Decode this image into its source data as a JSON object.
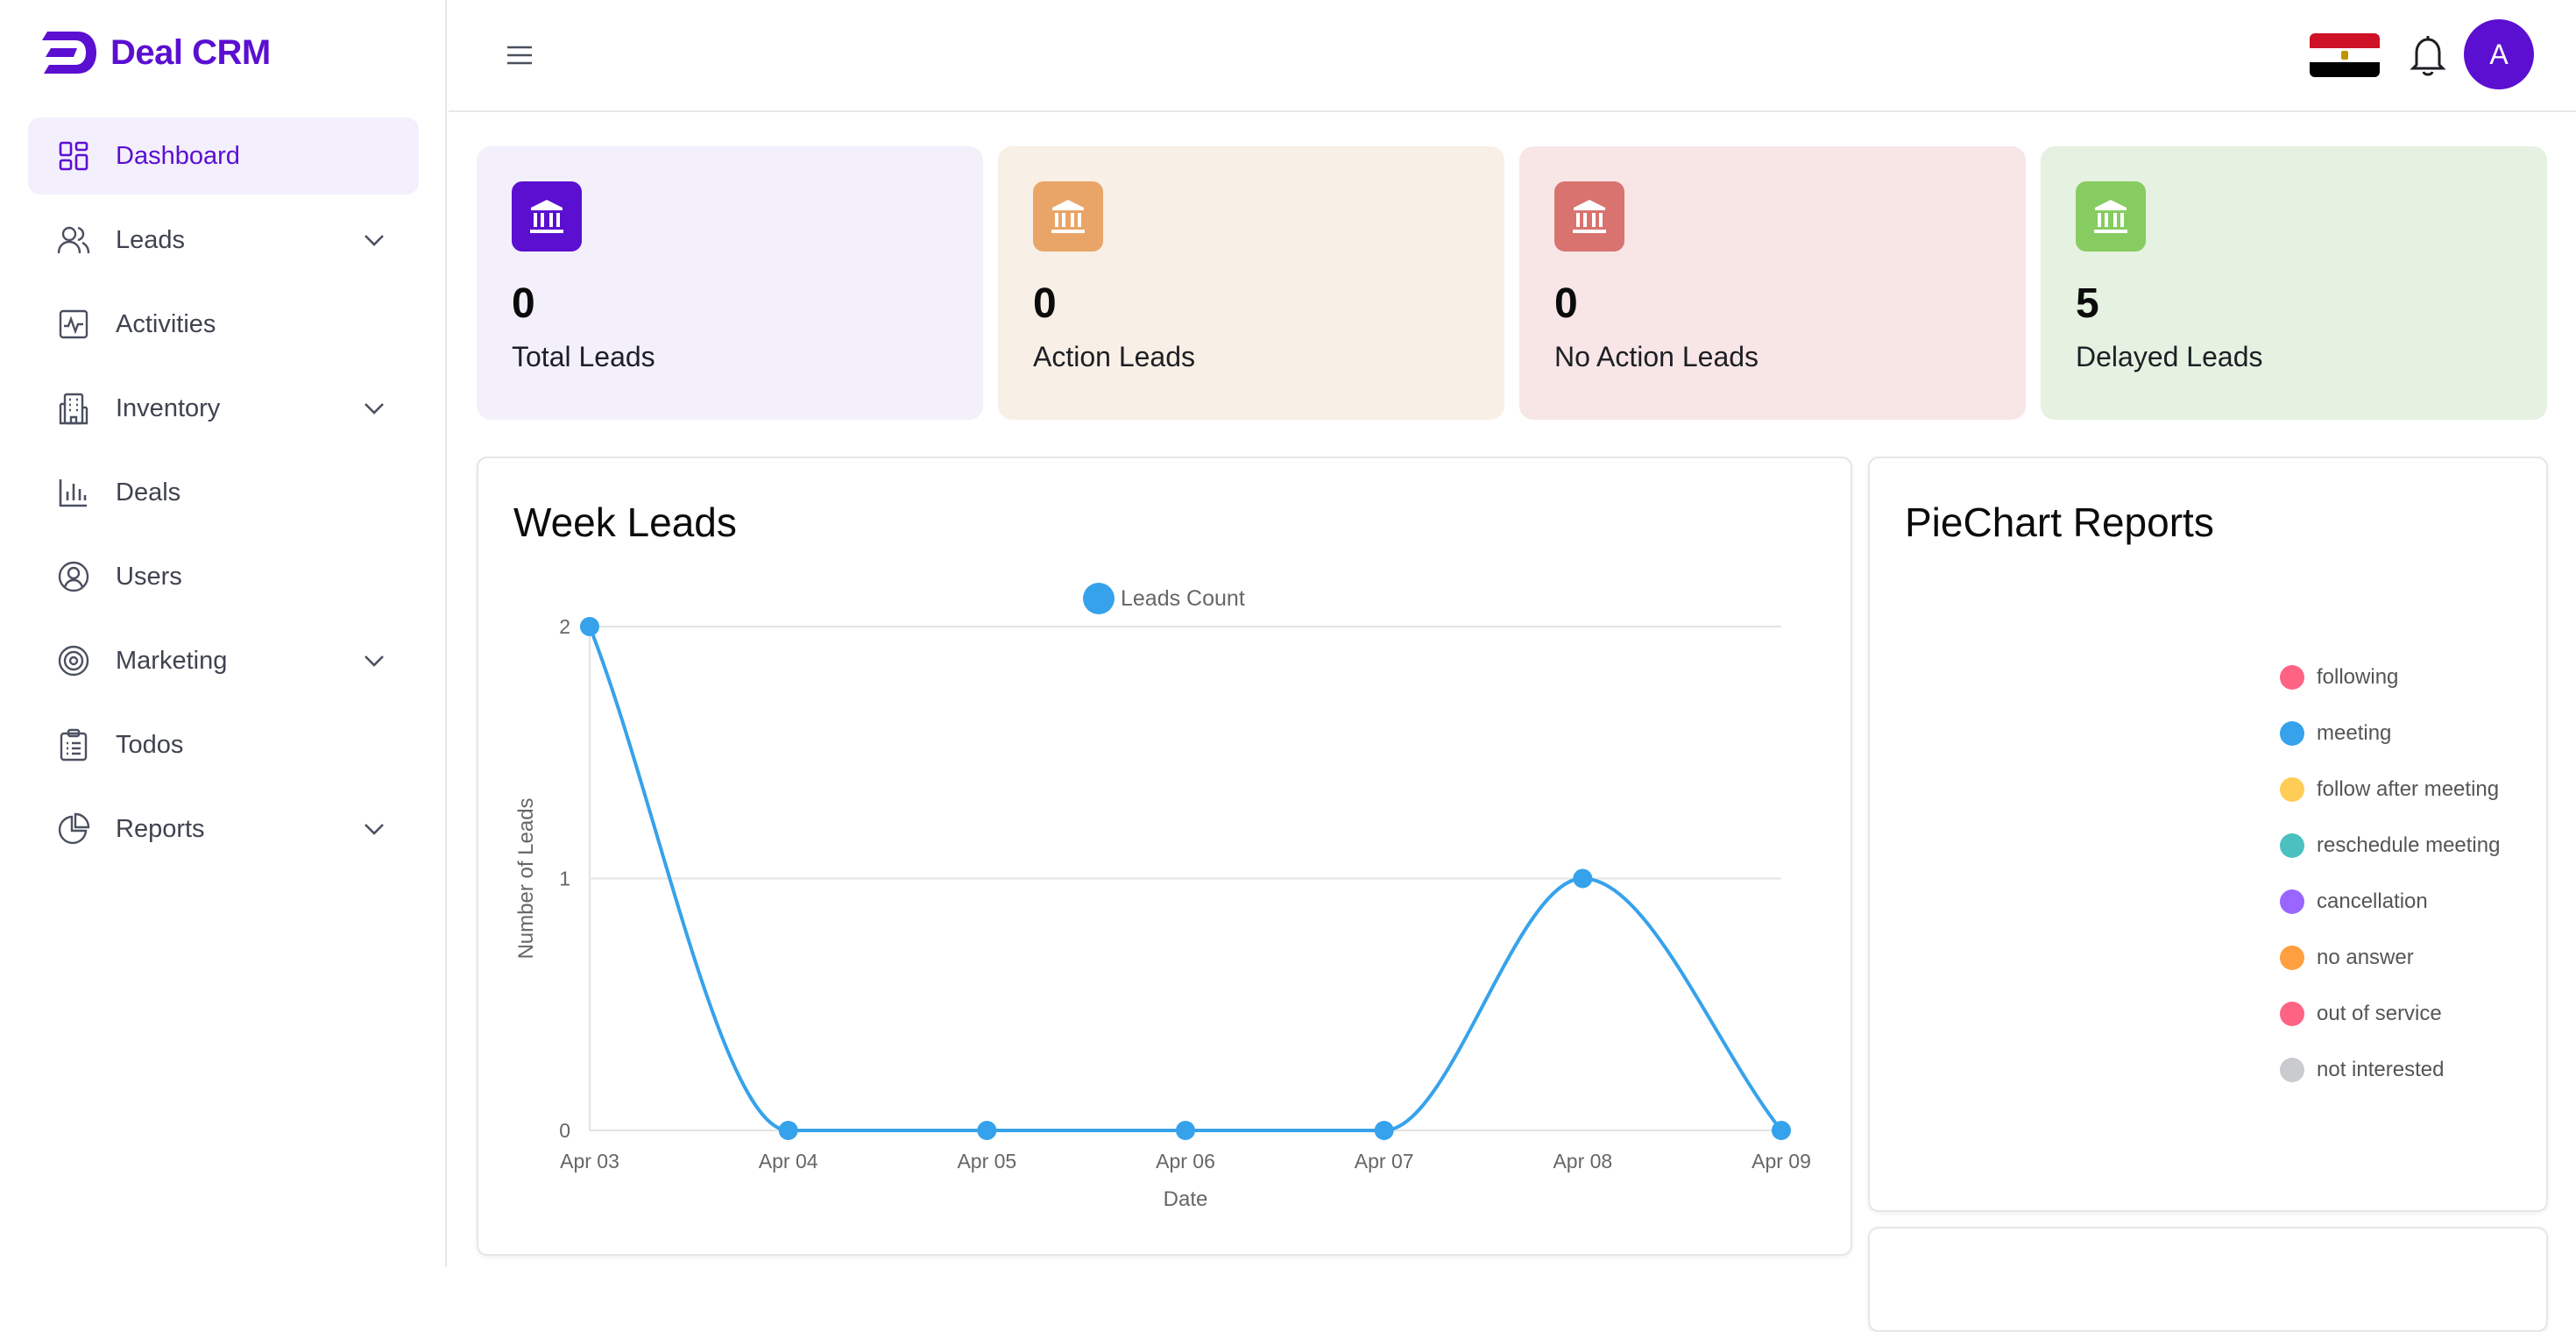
{
  "brand": {
    "name": "Deal CRM"
  },
  "sidebar": {
    "items": [
      {
        "label": "Dashboard",
        "icon": "dashboard-grid-icon",
        "active": true,
        "expandable": false
      },
      {
        "label": "Leads",
        "icon": "users-icon",
        "active": false,
        "expandable": true
      },
      {
        "label": "Activities",
        "icon": "activity-pulse-icon",
        "active": false,
        "expandable": false
      },
      {
        "label": "Inventory",
        "icon": "building-icon",
        "active": false,
        "expandable": true
      },
      {
        "label": "Deals",
        "icon": "bar-chart-icon",
        "active": false,
        "expandable": false
      },
      {
        "label": "Users",
        "icon": "user-circle-icon",
        "active": false,
        "expandable": false
      },
      {
        "label": "Marketing",
        "icon": "target-icon",
        "active": false,
        "expandable": true
      },
      {
        "label": "Todos",
        "icon": "clipboard-icon",
        "active": false,
        "expandable": false
      },
      {
        "label": "Reports",
        "icon": "pie-chart-icon",
        "active": false,
        "expandable": true
      }
    ]
  },
  "header": {
    "avatar_initial": "A",
    "language_flag": "egypt-flag-icon"
  },
  "stats": [
    {
      "value": "0",
      "label": "Total Leads",
      "bg": "#f3f0fc",
      "icon_bg": "#5b0fd1"
    },
    {
      "value": "0",
      "label": "Action Leads",
      "bg": "#f8efe6",
      "icon_bg": "#e9a567"
    },
    {
      "value": "0",
      "label": "No Action Leads",
      "bg": "#f8e6e6",
      "icon_bg": "#d9736f"
    },
    {
      "value": "5",
      "label": "Delayed Leads",
      "bg": "#e5f1e1",
      "icon_bg": "#86cc60"
    }
  ],
  "week_leads": {
    "title": "Week Leads",
    "chart_data": {
      "type": "line",
      "categories": [
        "Apr 03",
        "Apr 04",
        "Apr 05",
        "Apr 06",
        "Apr 07",
        "Apr 08",
        "Apr 09"
      ],
      "series": [
        {
          "name": "Leads Count",
          "values": [
            2,
            0,
            0,
            0,
            0,
            1,
            0
          ],
          "color": "#36a2eb"
        }
      ],
      "xlabel": "Date",
      "ylabel": "Number of Leads",
      "ylim": [
        0,
        2
      ],
      "yticks": [
        "0",
        "1",
        "2"
      ],
      "grid": true,
      "legend": "top"
    }
  },
  "pie_reports": {
    "title": "PieChart Reports",
    "legend": [
      {
        "label": "following",
        "color": "#ff6384"
      },
      {
        "label": "meeting",
        "color": "#36a2eb"
      },
      {
        "label": "follow after meeting",
        "color": "#ffcd56"
      },
      {
        "label": "reschedule meeting",
        "color": "#4bc0c0"
      },
      {
        "label": "cancellation",
        "color": "#9966ff"
      },
      {
        "label": "no answer",
        "color": "#ff9f40"
      },
      {
        "label": "out of service",
        "color": "#ff6384"
      },
      {
        "label": "not interested",
        "color": "#c9cbcf"
      }
    ]
  }
}
